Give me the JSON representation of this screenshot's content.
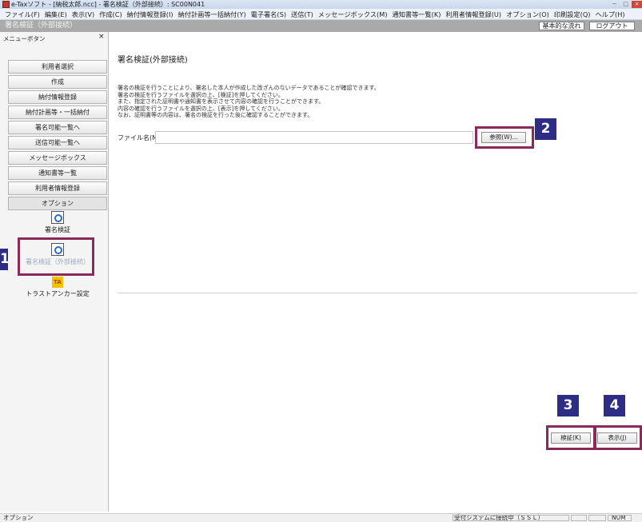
{
  "window": {
    "title": "e-Taxソフト - [納税太郎.ncc] - 署名検証（外部接続）: SC00N041",
    "controls": [
      "−",
      "□",
      "×"
    ]
  },
  "menubar": [
    "ファイル(F)",
    "編集(E)",
    "表示(V)",
    "作成(C)",
    "納付情報登録(I)",
    "納付計画等一括納付(Y)",
    "電子署名(S)",
    "送信(T)",
    "メッセージボックス(M)",
    "通知書等一覧(K)",
    "利用者情報登録(U)",
    "オプション(O)",
    "印刷設定(Q)",
    "ヘルプ(H)"
  ],
  "header": {
    "title": "署名検証（外部接続）",
    "flow_button": "基本的な流れ",
    "logout_button": "ログアウト"
  },
  "sidebar": {
    "caption": "メニューボタン",
    "close_glyph": "×",
    "items": [
      "利用者選択",
      "作成",
      "納付情報登録",
      "納付計画等・一括納付",
      "署名可能一覧へ",
      "送信可能一覧へ",
      "メッセージボックス",
      "通知書等一覧",
      "利用者情報登録",
      "オプション"
    ],
    "icons": [
      {
        "label": "署名検証",
        "icon": "signature-verify-icon"
      },
      {
        "label": "署名検証（外部接続）",
        "icon": "signature-verify-external-icon"
      },
      {
        "label": "トラストアンカー設定",
        "icon": "trust-anchor-icon",
        "glyph": "TA"
      }
    ]
  },
  "main": {
    "title": "署名検証(外部接続)",
    "description": [
      "署名の検証を行うことにより、署名した本人が作成した改ざんのないデータであることが確認できます。",
      "署名の検証を行うファイルを選択の上、[検証]を押してください。",
      "また、指定された証明書や通知書を表示させて内容の確認を行うことができます。",
      "内容の確認を行うファイルを選択の上、[表示]を押してください。",
      "なお、証明書等の内容は、署名の検証を行った後に確認することができます。"
    ],
    "file_label": "ファイル名(N)",
    "file_value": "",
    "browse_button": "参照(W)...",
    "verify_button": "検証(K)",
    "display_button": "表示(J)"
  },
  "callouts": [
    "1",
    "2",
    "3",
    "4"
  ],
  "statusbar": {
    "left": "オプション",
    "connection": "受付システムに接続中（ＳＳＬ）",
    "num": "NUM"
  },
  "colors": {
    "header_band": "#a9aaa9",
    "callout_badge": "#2d2d86",
    "callout_border": "#8a2a5a"
  }
}
